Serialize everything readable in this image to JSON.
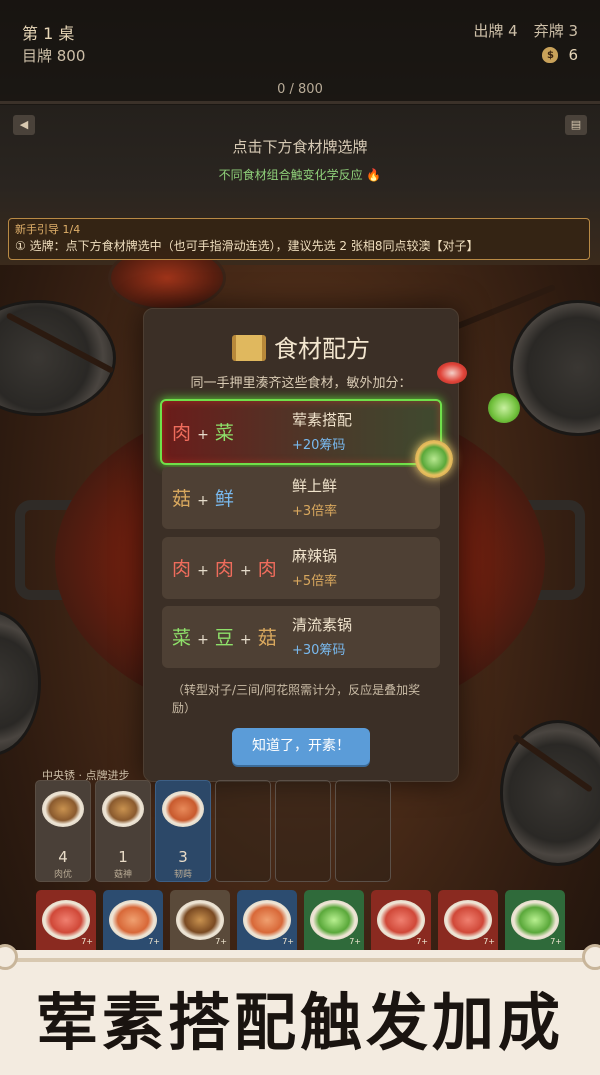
{
  "status": {
    "table": "第 1 桌",
    "target": "目牌 800",
    "plays": "出牌 4",
    "discards": "弃牌 3",
    "money": "6",
    "money_icon": "$"
  },
  "progress": {
    "text": "0 / 800",
    "current": 0,
    "target": 800
  },
  "controls": {
    "left_icon": "◀",
    "right_icon": "▤"
  },
  "hints": {
    "line1": "点击下方食材牌选牌",
    "line2": "不同食材组合触变化学反应 🔥"
  },
  "guide": {
    "title": "新手引导 1/4",
    "text": "① 选牌：点下方食材牌选中（也可手指滑动连选），建议先选 2 张相8同点较澳【对子】"
  },
  "modal": {
    "title": "食材配方",
    "subtitle": "同一手押里湊齐这些食材，敏外加分：",
    "recipes": [
      {
        "parts": [
          "肉",
          "菜"
        ],
        "name": "荤素搭配",
        "bonus": "+20筹码"
      },
      {
        "parts": [
          "菇",
          "鲜"
        ],
        "name": "鲜上鲜",
        "bonus": "+3倍率"
      },
      {
        "parts": [
          "肉",
          "肉",
          "肉"
        ],
        "name": "麻辣锅",
        "bonus": "+5倍率"
      },
      {
        "parts": [
          "菜",
          "豆",
          "菇"
        ],
        "name": "清流素锅",
        "bonus": "+30筹码"
      }
    ],
    "plus": "+",
    "note": "（转型对子/三间/阿花照需计分，反应是叠加奖励）",
    "button": "知道了，开素！"
  },
  "played": {
    "label": "中央锈 · 点牌进步",
    "slots": [
      {
        "num": "4",
        "name": "肉优"
      },
      {
        "num": "1",
        "name": "菇神"
      },
      {
        "num": "3",
        "name": "韧蒔"
      }
    ]
  },
  "hand_corner": "7+",
  "banner": "荤素搭配触发加成",
  "colors": {
    "meat": "#ef6c5c",
    "veg": "#8ee06a",
    "mush": "#d9a85e",
    "fresh": "#79b9ee",
    "button": "#5b9cd8",
    "glow": "#6fe04a"
  }
}
